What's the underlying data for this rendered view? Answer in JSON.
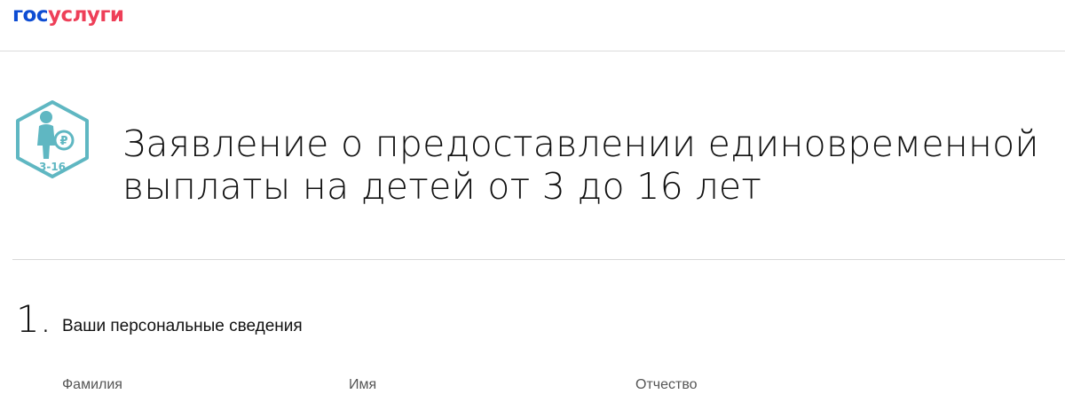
{
  "header": {
    "logo_part1": "гос",
    "logo_part2": "услуги",
    "colors": {
      "logo_blue": "#0d4cd3",
      "logo_red": "#ee3f58"
    }
  },
  "form": {
    "icon": {
      "name": "child-ruble-hexagon-icon",
      "label": "3-16",
      "color": "#5fb7c2"
    },
    "title": "Заявление о предоставлении единовременной выплаты на детей от 3 до 16 лет",
    "section": {
      "number": "1.",
      "title": "Ваши персональные сведения",
      "fields": [
        {
          "label": "Фамилия"
        },
        {
          "label": "Имя"
        },
        {
          "label": "Отчество"
        }
      ]
    }
  }
}
